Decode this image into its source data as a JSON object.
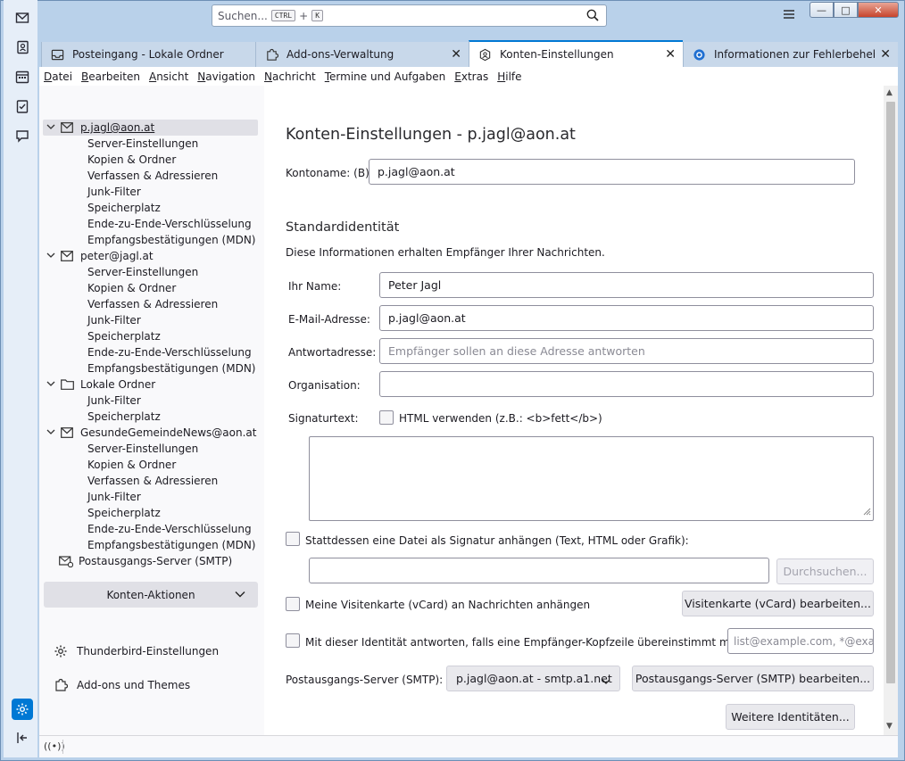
{
  "search": {
    "placeholder": "Suchen...",
    "kbd_ctrl": "CTRL",
    "plus": "+",
    "kbd_k": "K"
  },
  "window_buttons": {
    "minimize": "—",
    "maximize": "□",
    "close": "✕"
  },
  "tabs": [
    {
      "label": "Posteingang - Lokale Ordner",
      "icon": "inbox-icon"
    },
    {
      "label": "Add-ons-Verwaltung",
      "icon": "puzzle-icon"
    },
    {
      "label": "Konten-Einstellungen",
      "icon": "account-settings-icon"
    },
    {
      "label": "Informationen zur Fehlerbehebung",
      "icon": "thunderbird-icon"
    }
  ],
  "menubar": [
    {
      "first": "D",
      "rest": "atei"
    },
    {
      "first": "B",
      "rest": "earbeiten"
    },
    {
      "first": "A",
      "rest": "nsicht"
    },
    {
      "first": "N",
      "rest": "avigation"
    },
    {
      "first": "N",
      "rest": "achricht"
    },
    {
      "first": "T",
      "rest": "ermine und Aufgaben"
    },
    {
      "first": "E",
      "rest": "xtras"
    },
    {
      "first": "H",
      "rest": "ilfe"
    }
  ],
  "accounts": [
    {
      "name": "p.jagl@aon.at",
      "icon": "mail-icon",
      "selected": true,
      "children": [
        "Server-Einstellungen",
        "Kopien & Ordner",
        "Verfassen & Adressieren",
        "Junk-Filter",
        "Speicherplatz",
        "Ende-zu-Ende-Verschlüsselung",
        "Empfangsbestätigungen (MDN)"
      ]
    },
    {
      "name": "peter@jagl.at",
      "icon": "mail-icon",
      "selected": false,
      "children": [
        "Server-Einstellungen",
        "Kopien & Ordner",
        "Verfassen & Adressieren",
        "Junk-Filter",
        "Speicherplatz",
        "Ende-zu-Ende-Verschlüsselung",
        "Empfangsbestätigungen (MDN)"
      ]
    },
    {
      "name": "Lokale Ordner",
      "icon": "folder-icon",
      "selected": false,
      "children": [
        "Junk-Filter",
        "Speicherplatz"
      ]
    },
    {
      "name": "GesundeGemeindeNews@aon.at",
      "icon": "mail-icon",
      "selected": false,
      "children": [
        "Server-Einstellungen",
        "Kopien & Ordner",
        "Verfassen & Adressieren",
        "Junk-Filter",
        "Speicherplatz",
        "Ende-zu-Ende-Verschlüsselung",
        "Empfangsbestätigungen (MDN)"
      ]
    }
  ],
  "smtp_item": "Postausgangs-Server (SMTP)",
  "account_actions": "Konten-Aktionen",
  "sidebar_links": {
    "settings": "Thunderbird-Einstellungen",
    "addons": "Add-ons und Themes"
  },
  "pane": {
    "title": "Konten-Einstellungen - p.jagl@aon.at",
    "account_name_label": "Kontoname: (B)",
    "account_name_value": "p.jagl@aon.at",
    "identity_title": "Standardidentität",
    "identity_desc": "Diese Informationen erhalten Empfänger Ihrer Nachrichten.",
    "name_label": "Ihr Name:",
    "name_value": "Peter Jagl",
    "email_label": "E-Mail-Adresse:",
    "email_value": "p.jagl@aon.at",
    "reply_label": "Antwortadresse:",
    "reply_placeholder": "Empfänger sollen an diese Adresse antworten",
    "org_label": "Organisation:",
    "org_value": "",
    "signature_label": "Signaturtext:",
    "html_checkbox": "HTML verwenden (z.B.: <b>fett</b>)",
    "sig_file_checkbox": "Stattdessen eine Datei als Signatur anhängen (Text, HTML oder Grafik):",
    "browse_button": "Durchsuchen...",
    "vcard_checkbox": "Meine Visitenkarte (vCard) an Nachrichten anhängen",
    "vcard_button": "Visitenkarte (vCard) bearbeiten...",
    "reply_identity_checkbox": "Mit dieser Identität antworten, falls eine Empfänger-Kopfzeile übereinstimmt mit:",
    "reply_identity_placeholder": "list@example.com, *@example.com",
    "smtp_label": "Postausgangs-Server (SMTP):",
    "smtp_value": "p.jagl@aon.at - smtp.a1.net",
    "smtp_edit_button": "Postausgangs-Server (SMTP) bearbeiten...",
    "more_identities_button": "Weitere Identitäten..."
  }
}
